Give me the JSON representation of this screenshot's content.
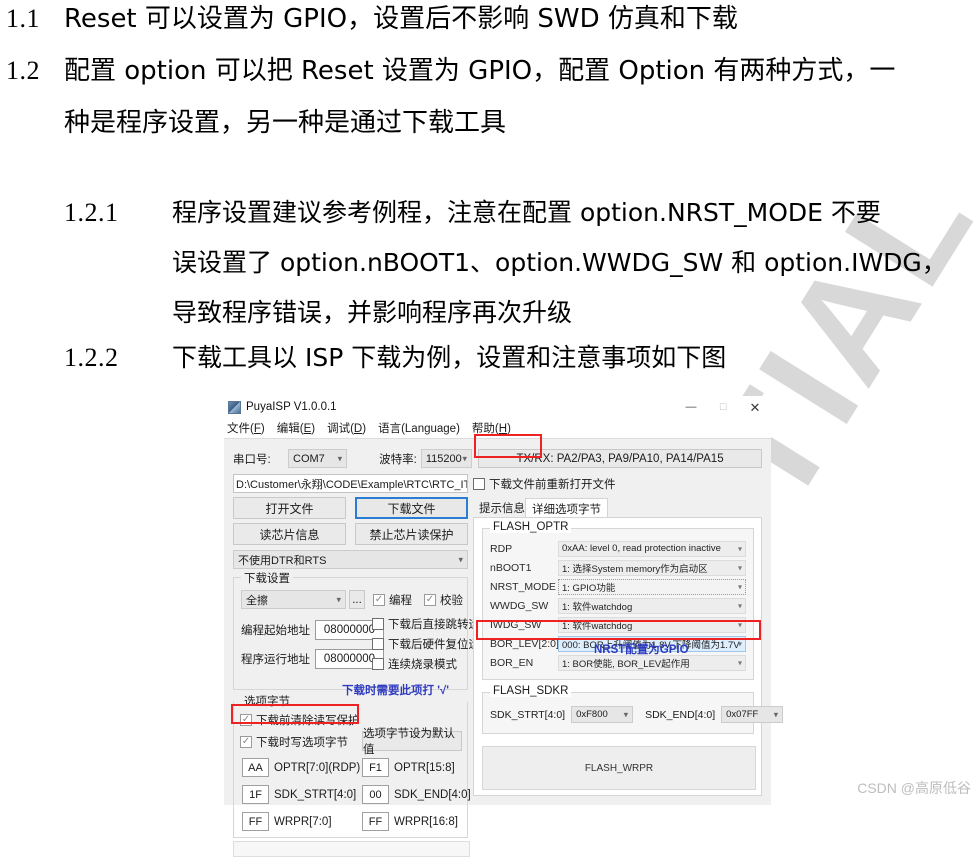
{
  "document": {
    "paragraphs": [
      {
        "num": "1.1",
        "text": "Reset 可以设置为 GPIO，设置后不影响 SWD 仿真和下载"
      },
      {
        "num": "1.2",
        "text": "配置 option  可以把 Reset 设置为 GPIO，配置 Option 有两种方式，一"
      },
      {
        "num": "",
        "text": "种是程序设置，另一种是通过下载工具"
      },
      {
        "num": "1.2.1",
        "text": "程序设置建议参考例程，注意在配置 option.NRST_MODE 不要"
      },
      {
        "num": "",
        "text": "误设置了 option.nBOOT1、option.WWDG_SW 和 option.IWDG，"
      },
      {
        "num": "",
        "text": "导致程序错误，并影响程序再次升级"
      },
      {
        "num": "1.2.2",
        "text": "下载工具以 ISP 下载为例，设置和注意事项如下图"
      }
    ]
  },
  "watermark": {
    "text": "TIAL"
  },
  "footer": {
    "csdn": "CSDN @高原低谷"
  },
  "app": {
    "title": "PuyaISP V1.0.0.1",
    "window_controls": {
      "minimize": "—",
      "maximize": "☐",
      "close": "✕"
    },
    "menu": [
      {
        "label": "文件(",
        "key": "F",
        "tail": ")"
      },
      {
        "label": "编辑(",
        "key": "E",
        "tail": ")"
      },
      {
        "label": "调试(",
        "key": "D",
        "tail": ")"
      },
      {
        "label": "语言(Language)",
        "key": "",
        "tail": ""
      },
      {
        "label": "帮助(",
        "key": "H",
        "tail": ")"
      }
    ],
    "toolbar": {
      "port_label": "串口号:",
      "port_value": "COM7",
      "baud_label": "波特率:",
      "baud_value": "115200",
      "txrx_info": "TX/RX: PA2/PA3, PA9/PA10, PA14/PA15"
    },
    "file_row": {
      "path_value": "D:\\Customer\\永翔\\CODE\\Example\\RTC\\RTC_IT\\MDK-",
      "reopen_checkbox": "下载文件前重新打开文件",
      "reopen_checked": false
    },
    "buttons": {
      "open_file": "打开文件",
      "download_file": "下载文件",
      "read_chip_info": "读芯片信息",
      "disable_read_protect": "禁止芯片读保护"
    },
    "dtr_combo": "不使用DTR和RTS",
    "download_settings": {
      "title": "下载设置",
      "erase_mode": "全擦",
      "browse_btn": "...",
      "program_cb": "编程",
      "program_checked": true,
      "verify_cb": "校验",
      "verify_checked": true,
      "jump_cb": "下载后直接跳转运行",
      "jump_checked": false,
      "hwreset_cb": "下载后硬件复位运行",
      "hwreset_checked": false,
      "continuous_cb": "连续烧录模式",
      "continuous_checked": false,
      "start_addr_label": "编程起始地址",
      "start_addr_value": "08000000",
      "run_addr_label": "程序运行地址",
      "run_addr_value": "08000000"
    },
    "option_bytes": {
      "title": "选项字节",
      "clear_protect_cb": "下载前清除读写保护",
      "clear_protect_checked": true,
      "write_option_cb": "下载时写选项字节",
      "write_option_checked": true,
      "default_btn": "选项字节设为默认值",
      "hex_rows": [
        {
          "lv": "AA",
          "lname": "OPTR[7:0](RDP)",
          "rv": "F1",
          "rname": "OPTR[15:8]"
        },
        {
          "lv": "1F",
          "lname": "SDK_STRT[4:0]",
          "rv": "00",
          "rname": "SDK_END[4:0]"
        },
        {
          "lv": "FF",
          "lname": "WRPR[7:0]",
          "rv": "FF",
          "rname": "WRPR[16:8]"
        }
      ]
    },
    "tabs": [
      {
        "label": "提示信息",
        "active": false
      },
      {
        "label": "详细选项字节",
        "active": true
      }
    ],
    "flash_optr": {
      "title": "FLASH_OPTR",
      "rows": [
        {
          "name": "RDP",
          "value": "0xAA: level 0, read protection inactive",
          "style": "normal"
        },
        {
          "name": "nBOOT1",
          "value": "1: 选择System memory作为启动区",
          "style": "normal"
        },
        {
          "name": "NRST_MODE",
          "value": "1: GPIO功能",
          "style": "dotted"
        },
        {
          "name": "WWDG_SW",
          "value": "1: 软件watchdog",
          "style": "normal"
        },
        {
          "name": "IWDG_SW",
          "value": "1: 软件watchdog",
          "style": "normal"
        },
        {
          "name": "BOR_LEV[2:0]",
          "value": "000: BOR上升阈值为1.8V,下降阈值为1.7V",
          "style": "highlighted"
        },
        {
          "name": "BOR_EN",
          "value": "1: BOR使能, BOR_LEV起作用",
          "style": "normal"
        }
      ]
    },
    "flash_sdkr": {
      "title": "FLASH_SDKR",
      "strt_label": "SDK_STRT[4:0]",
      "strt_value": "0xF800",
      "end_label": "SDK_END[4:0]",
      "end_value": "0x07FF"
    },
    "flash_wrpr": {
      "label": "FLASH_WRPR"
    },
    "annotations": {
      "blue_note_1": "下载时需要此项打 '√'",
      "blue_note_2": "NRST配置为GPIO"
    }
  }
}
